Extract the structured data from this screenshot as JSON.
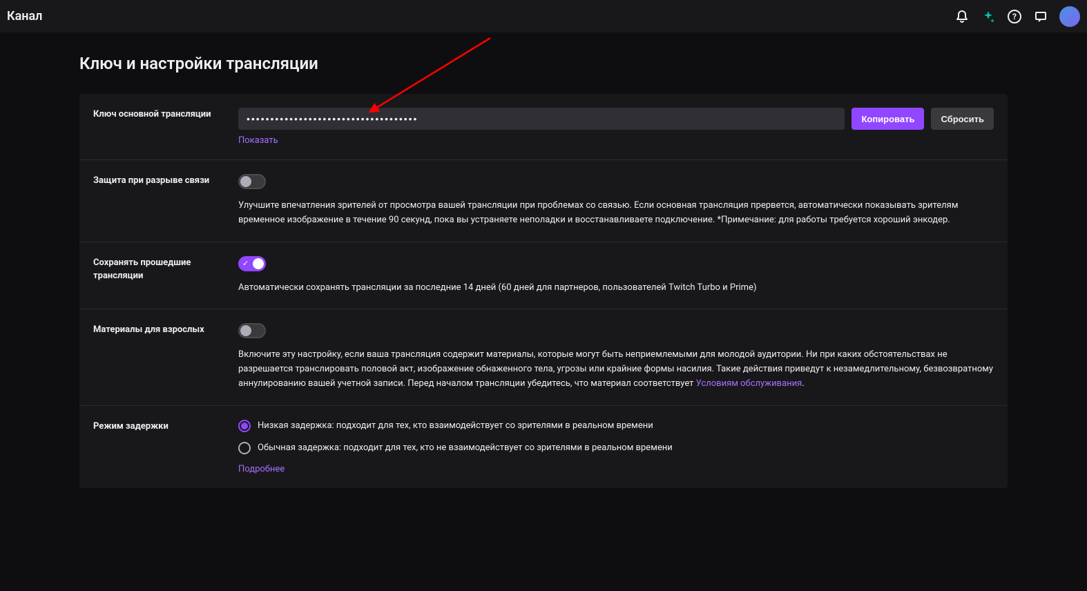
{
  "header": {
    "title": "Канал"
  },
  "page": {
    "title": "Ключ и настройки трансляции"
  },
  "settings": {
    "stream_key": {
      "label": "Ключ основной трансляции",
      "value": "••••••••••••••••••••••••••••••••••••",
      "copy_button": "Копировать",
      "reset_button": "Сбросить",
      "show_link": "Показать"
    },
    "disconnect_protection": {
      "label": "Защита при разрыве связи",
      "enabled": false,
      "description": "Улучшите впечатления зрителей от просмотра вашей трансляции при проблемах со связью. Если основная трансляция прервется, автоматически показывать зрителям временное изображение в течение 90 секунд, пока вы устраняете неполадки и восстанавливаете подключение. *Примечание: для работы требуется хороший энкодер."
    },
    "store_vods": {
      "label": "Сохранять прошедшие трансляции",
      "enabled": true,
      "description": "Автоматически сохранять трансляции за последние 14 дней (60 дней для партнеров, пользователей Twitch Turbo и Prime)"
    },
    "mature_content": {
      "label": "Материалы для взрослых",
      "enabled": false,
      "description_pre": "Включите эту настройку, если ваша трансляция содержит материалы, которые могут быть неприемлемыми для молодой аудитории. Ни при каких обстоятельствах не разрешается транслировать половой акт, изображение обнаженного тела, угрозы или крайние формы насилия. Такие действия приведут к незамедлительному, безвозвратному аннулированию вашей учетной записи. Перед началом трансляции убедитесь, что материал соответствует ",
      "tos_link": "Условиям обслуживания",
      "description_post": "."
    },
    "latency_mode": {
      "label": "Режим задержки",
      "low_option": "Низкая задержка: подходит для тех, кто взаимодействует со зрителями в реальном времени",
      "normal_option": "Обычная задержка: подходит для тех, кто не взаимодействует со зрителями в реальном времени",
      "selected": "low",
      "more_link": "Подробнее"
    }
  }
}
